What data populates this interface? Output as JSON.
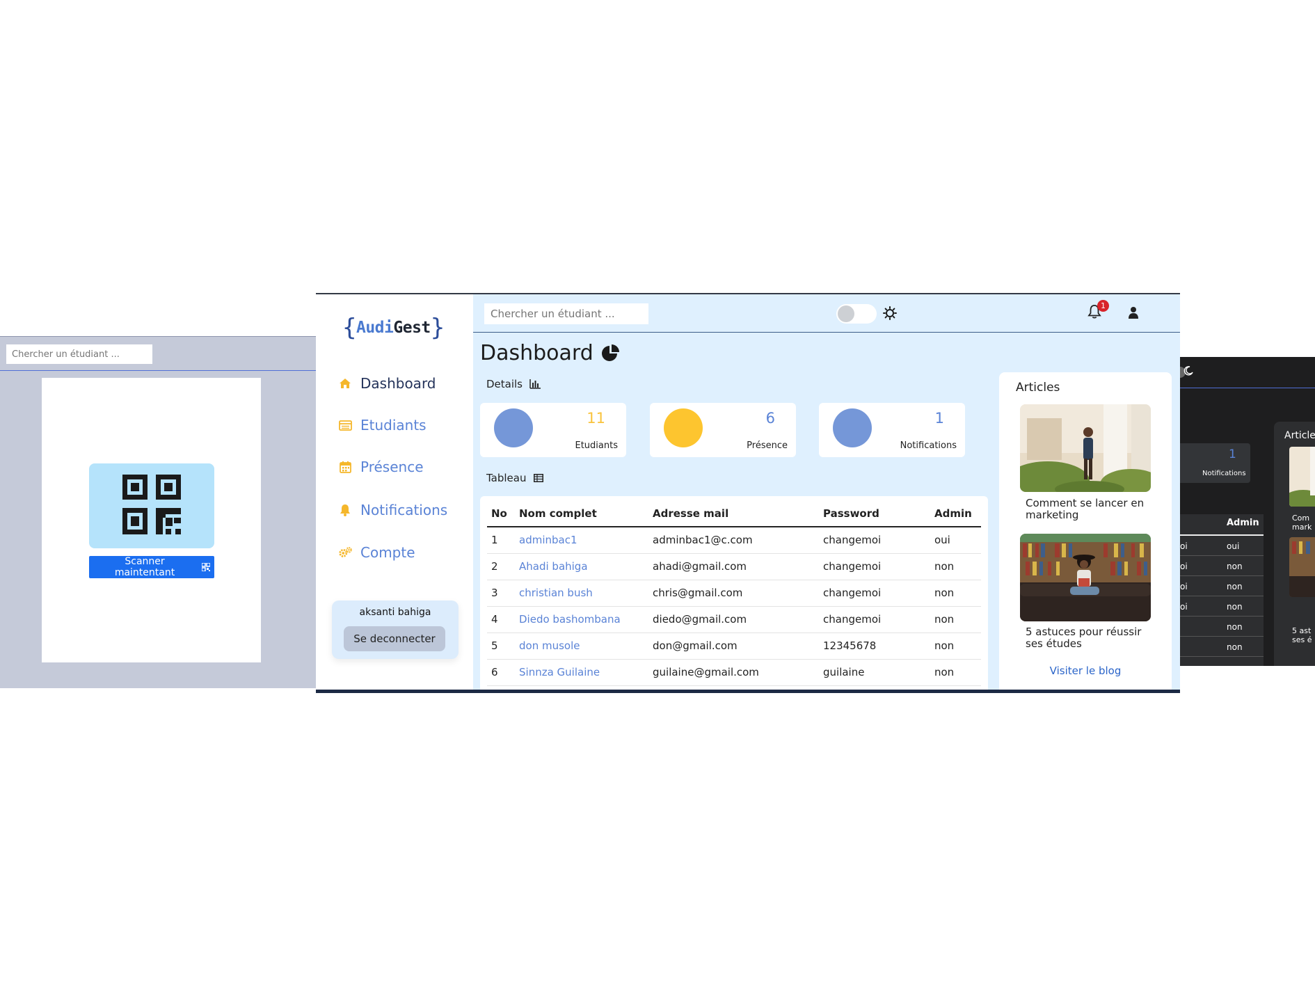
{
  "left_panel": {
    "search_placeholder": "Chercher un étudiant ...",
    "scan_button_label": "Scanner maintentant"
  },
  "app": {
    "logo": {
      "bracket_open": "{",
      "part1": "Audi",
      "part2": "Gest",
      "bracket_close": "}"
    },
    "nav": [
      {
        "label": "Dashboard",
        "icon": "home-icon",
        "active": true
      },
      {
        "label": "Etudiants",
        "icon": "list-icon",
        "active": false
      },
      {
        "label": "Présence",
        "icon": "calendar-icon",
        "active": false
      },
      {
        "label": "Notifications",
        "icon": "bell-icon",
        "active": false
      },
      {
        "label": "Compte",
        "icon": "gears-icon",
        "active": false
      }
    ],
    "user": {
      "name": "aksanti bahiga",
      "logout_label": "Se deconnecter"
    },
    "topbar": {
      "search_placeholder": "Chercher un étudiant ...",
      "notification_count": "1"
    },
    "title": "Dashboard",
    "details_label": "Details",
    "stats": [
      {
        "value": "11",
        "label": "Etudiants",
        "circle_color": "#7597d8",
        "value_color": "#f9c33d"
      },
      {
        "value": "6",
        "label": "Présence",
        "circle_color": "#fdc52f",
        "value_color": "#5a83d6"
      },
      {
        "value": "1",
        "label": "Notifications",
        "circle_color": "#7597d8",
        "value_color": "#5a83d6"
      }
    ],
    "tableau_label": "Tableau",
    "table": {
      "headers": [
        "No",
        "Nom complet",
        "Adresse mail",
        "Password",
        "Admin"
      ],
      "rows": [
        [
          "1",
          "adminbac1",
          "adminbac1@c.com",
          "changemoi",
          "oui"
        ],
        [
          "2",
          "Ahadi bahiga",
          "ahadi@gmail.com",
          "changemoi",
          "non"
        ],
        [
          "3",
          "christian bush",
          "chris@gmail.com",
          "changemoi",
          "non"
        ],
        [
          "4",
          "Diedo bashombana",
          "diedo@gmail.com",
          "changemoi",
          "non"
        ],
        [
          "5",
          "don musole",
          "don@gmail.com",
          "12345678",
          "non"
        ],
        [
          "6",
          "Sinnza Guilaine",
          "guilaine@gmail.com",
          "guilaine",
          "non"
        ]
      ]
    },
    "articles": {
      "title": "Articles",
      "items": [
        {
          "caption": "Comment se lancer en marketing"
        },
        {
          "caption": "5 astuces pour réussir ses études"
        }
      ],
      "blog_link": "Visiter le blog"
    }
  },
  "right_panel": {
    "notif_value": "1",
    "notif_label": "Notifications",
    "table_header": "Admin",
    "rows": [
      {
        "c1": "oi",
        "c2": "oui"
      },
      {
        "c1": "oi",
        "c2": "non"
      },
      {
        "c1": "oi",
        "c2": "non"
      },
      {
        "c1": "oi",
        "c2": "non"
      },
      {
        "c1": "",
        "c2": "non"
      },
      {
        "c1": "",
        "c2": "non"
      }
    ],
    "articles_title": "Article",
    "cap1_line1": "Com",
    "cap1_line2": "mark",
    "cap2_line1": "5 ast",
    "cap2_line2": "ses é"
  }
}
